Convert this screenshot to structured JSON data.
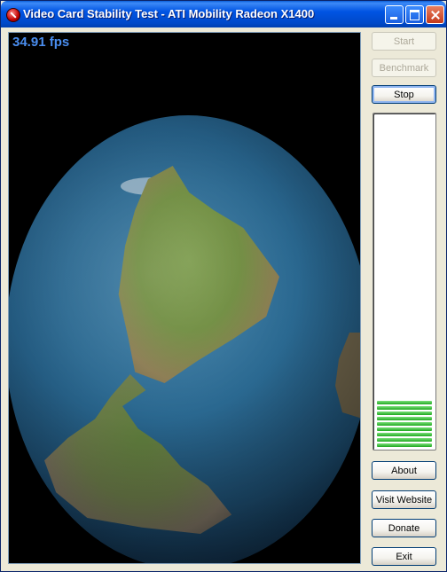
{
  "window": {
    "title": "Video Card Stability Test - ATI Mobility Radeon X1400"
  },
  "render": {
    "fps": "34.91 fps"
  },
  "controls": {
    "start": "Start",
    "benchmark": "Benchmark",
    "stop": "Stop",
    "about": "About",
    "visit_website": "Visit Website",
    "donate": "Donate",
    "exit": "Exit"
  },
  "meter": {
    "bars": 9
  },
  "colors": {
    "fps_text": "#4a8ef0",
    "meter_bar": "#1fa81f",
    "titlebar": "#0054e3"
  }
}
